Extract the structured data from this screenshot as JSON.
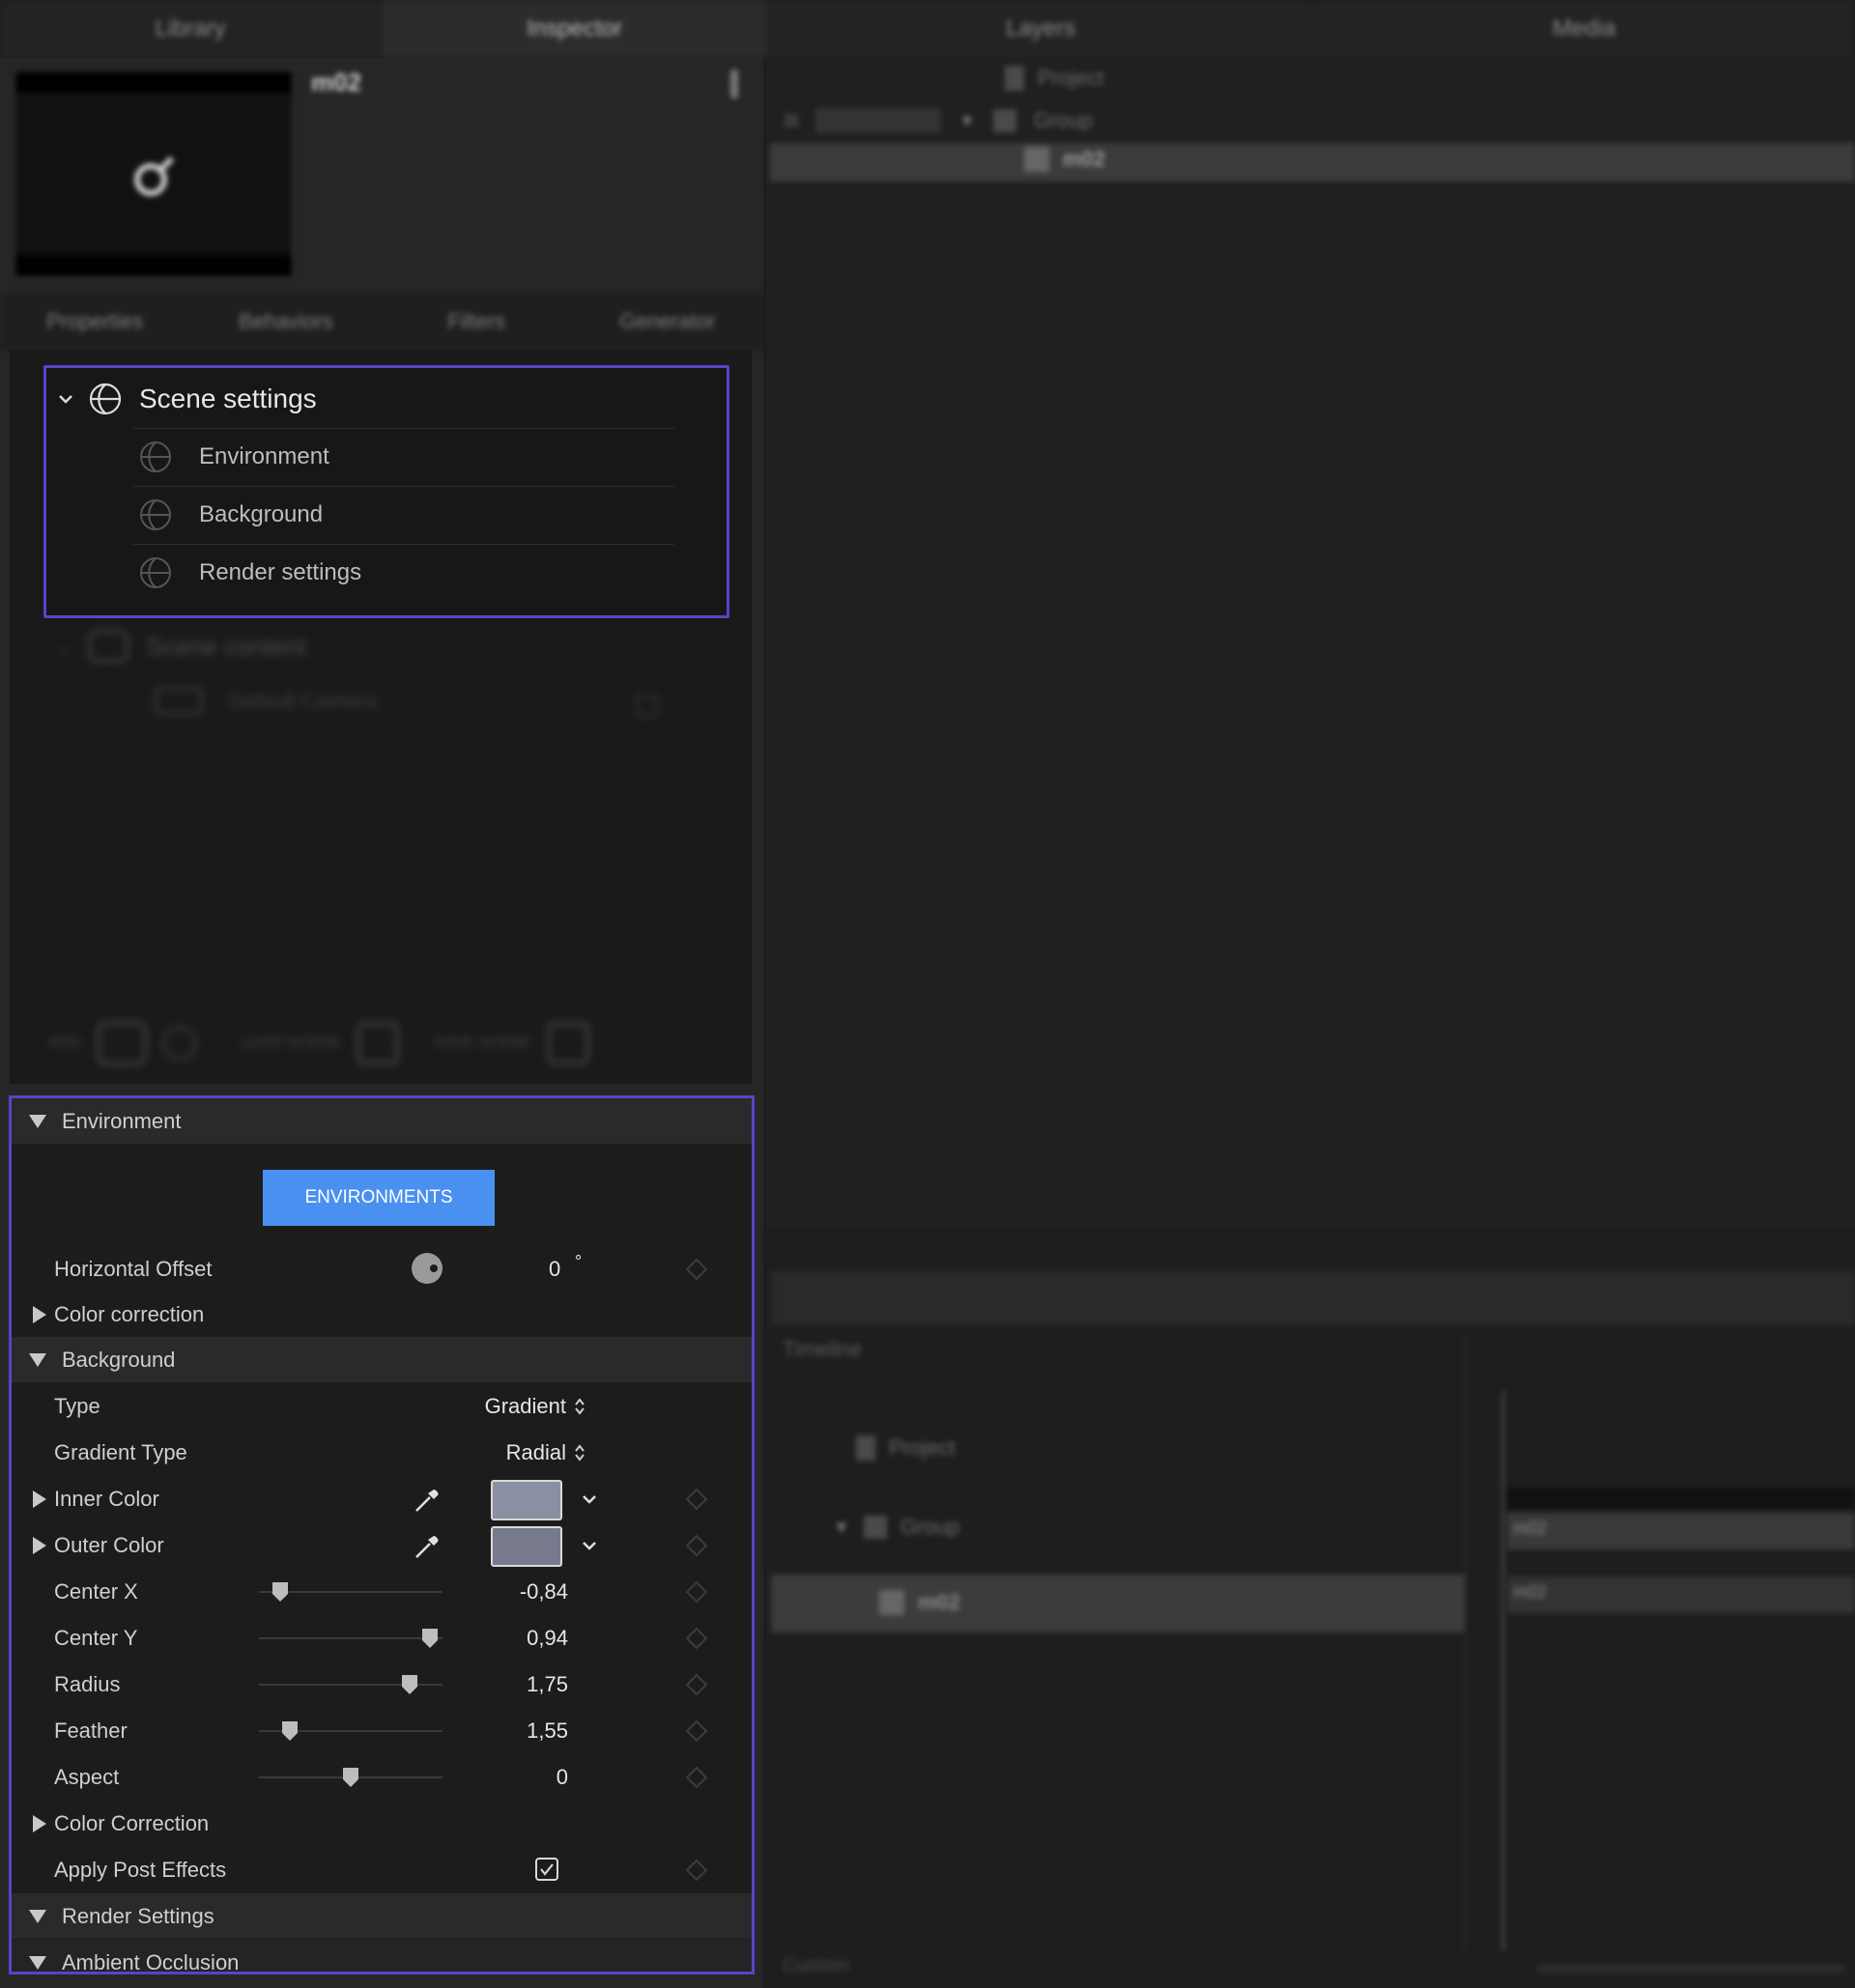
{
  "top_tabs": [
    "Library",
    "Inspector",
    "Layers",
    "Media"
  ],
  "preview": {
    "name": "m02"
  },
  "sub_tabs": [
    "Properties",
    "Behaviors",
    "Filters",
    "Generator"
  ],
  "scene_tree": {
    "scene_settings": "Scene settings",
    "children": [
      "Environment",
      "Background",
      "Render settings"
    ],
    "scene_content": "Scene content",
    "default_camera": "Default Camera"
  },
  "scene_toolbar": {
    "add": "ADD",
    "load_scene": "LOAD SCENE",
    "save_scene": "SAVE SCENE"
  },
  "inspector": {
    "environment": {
      "title": "Environment",
      "button": "ENVIRONMENTS",
      "horizontal_offset": {
        "label": "Horizontal Offset",
        "value": "0",
        "unit": "°"
      },
      "color_correction": "Color correction"
    },
    "background": {
      "title": "Background",
      "type": {
        "label": "Type",
        "value": "Gradient"
      },
      "gradient_type": {
        "label": "Gradient Type",
        "value": "Radial"
      },
      "inner_color": {
        "label": "Inner Color",
        "color": "#8a8fa3"
      },
      "outer_color": {
        "label": "Outer Color",
        "color": "#767a8c"
      },
      "center_x": {
        "label": "Center X",
        "value": "-0,84",
        "level": 0.08
      },
      "center_y": {
        "label": "Center Y",
        "value": "0,94",
        "level": 0.97
      },
      "radius": {
        "label": "Radius",
        "value": "1,75",
        "level": 0.85
      },
      "feather": {
        "label": "Feather",
        "value": "1,55",
        "level": 0.14
      },
      "aspect": {
        "label": "Aspect",
        "value": "0",
        "level": 0.5
      },
      "color_correction": "Color Correction",
      "apply_post_effects": {
        "label": "Apply Post Effects",
        "checked": true
      }
    },
    "render_settings": {
      "title": "Render Settings"
    },
    "ambient_occlusion": {
      "title": "Ambient Occlusion"
    }
  },
  "layers": {
    "project": "Project",
    "group": "Group",
    "item": "m02"
  },
  "timeline": {
    "title": "Timeline",
    "project": "Project",
    "group": "Group",
    "item": "m02",
    "footer_label": "Custom"
  },
  "accent": "#5446c9",
  "button_color": "#4a90f0"
}
